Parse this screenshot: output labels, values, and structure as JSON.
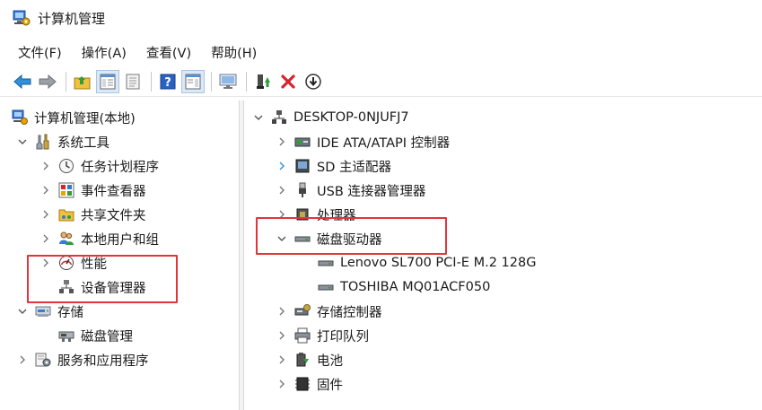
{
  "window": {
    "title": "计算机管理"
  },
  "menu": [
    "文件(F)",
    "操作(A)",
    "查看(V)",
    "帮助(H)"
  ],
  "toolbar": {
    "buttons": [
      "back-icon",
      "forward-icon",
      "up-folder-icon",
      "show-tree-icon",
      "properties-icon",
      "help-icon",
      "action-pane-icon",
      "monitor-icon",
      "update-driver-icon",
      "uninstall-icon",
      "enable-device-icon"
    ]
  },
  "left_tree": {
    "root": "计算机管理(本地)",
    "system_tools": "系统工具",
    "task_scheduler": "任务计划程序",
    "event_viewer": "事件查看器",
    "shared_folders": "共享文件夹",
    "local_users": "本地用户和组",
    "performance": "性能",
    "device_manager": "设备管理器",
    "storage": "存储",
    "disk_management": "磁盘管理",
    "services": "服务和应用程序"
  },
  "right_tree": {
    "computer": "DESKTOP-0NJUFJ7",
    "ide": "IDE ATA/ATAPI 控制器",
    "sd": "SD 主适配器",
    "usb": "USB 连接器管理器",
    "cpu": "处理器",
    "disk_drives": "磁盘驱动器",
    "disk1": "Lenovo SL700 PCI-E M.2 128G",
    "disk2": "TOSHIBA MQ01ACF050",
    "storage_ctrl": "存储控制器",
    "print_queue": "打印队列",
    "battery": "电池",
    "firmware": "固件"
  },
  "colors": {
    "highlight": "#e0353a",
    "selected_bg": "#cce4f7"
  }
}
